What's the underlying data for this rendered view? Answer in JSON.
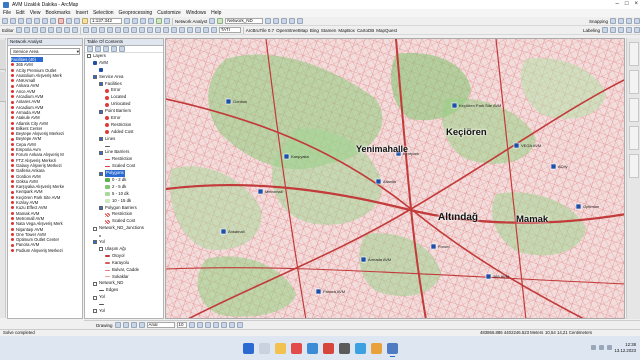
{
  "window": {
    "title": "AVM Uzaklık Dakika - ArcMap"
  },
  "menu": [
    "File",
    "Edit",
    "View",
    "Bookmarks",
    "Insert",
    "Selection",
    "Geoprocessing",
    "Customize",
    "Windows",
    "Help"
  ],
  "toolbar": {
    "scale": "1:137.342",
    "network_analyst_label": "Network Analyst",
    "network_dataset": "Network_ND",
    "georeferencing_layer": "TATI",
    "arcbrutile": "ArcBruTile 0.7",
    "osm": "OpenStreetMap",
    "bing": "Bing",
    "stamen": "Stamen",
    "mapbox": "MapBox",
    "cartodb": "CartoDB",
    "mapquest": "MapQuest",
    "snapping": "Snapping",
    "labeling": "Labeling",
    "editor": "Editor",
    "font": "Arial",
    "font_size": "10"
  },
  "network_analyst_panel": {
    "title": "Network Analyst",
    "selected_layer": "Service Area",
    "facilities_header": "Facilities (40)",
    "facilities": [
      "365 AVM",
      "ACity Premium Outlet",
      "Anatolium Alışveriş Merk",
      "ANKAmall",
      "Ankara AVM",
      "Ance AVM",
      "Arcadium AVM",
      "Antares AVM",
      "Arcadium AVM",
      "Armada AVM",
      "Atakule AVM",
      "Atlantis City AVM",
      "Bilkent Center",
      "Beytepe Alışveriş Merkezi",
      "Beytepe AVM",
      "Cepa AVM",
      "Emporia Avm",
      "Forum Ankara Alışveriş M",
      "FTZ Alışveriş Merkezi",
      "Galaxy Alışveriş Merkezi",
      "Galleria Ankara",
      "Gordion AVM",
      "Göksu AVM",
      "Karşıyaka Alışveriş Merke",
      "Kentpark AVM",
      "Keçiören Park Site AVM",
      "Kızılay AVM",
      "Kuzu Effect AVM",
      "Mamak AVM",
      "Metromall AVM",
      "Nata Vega Alışveriş Merk",
      "Nişantaşı AVM",
      "One Tower AVM",
      "Optimum Outlet Center",
      "Panora AVM",
      "Podium Alışveriş Merkezi"
    ],
    "status": "Solve completed"
  },
  "toc": {
    "title": "Table Of Contents",
    "items": [
      {
        "label": "Layers",
        "level": 0,
        "check": false,
        "sym": ""
      },
      {
        "label": "AVM",
        "level": 1,
        "check": true,
        "sym": "pin"
      },
      {
        "label": "",
        "level": 2,
        "check": false,
        "sym": "pin"
      },
      {
        "label": "Service Area",
        "level": 1,
        "check": true,
        "sym": ""
      },
      {
        "label": "Facilities",
        "level": 2,
        "check": true,
        "sym": ""
      },
      {
        "label": "Error",
        "level": 3,
        "check": false,
        "sym": "red"
      },
      {
        "label": "Located",
        "level": 3,
        "check": false,
        "sym": "red"
      },
      {
        "label": "Unlocated",
        "level": 3,
        "check": false,
        "sym": "red"
      },
      {
        "label": "Point Barriers",
        "level": 2,
        "check": true,
        "sym": ""
      },
      {
        "label": "Error",
        "level": 3,
        "check": false,
        "sym": "red"
      },
      {
        "label": "Restriction",
        "level": 3,
        "check": false,
        "sym": "red"
      },
      {
        "label": "Added Cost",
        "level": 3,
        "check": false,
        "sym": "red"
      },
      {
        "label": "Lines",
        "level": 2,
        "check": true,
        "sym": ""
      },
      {
        "label": "",
        "level": 3,
        "check": false,
        "sym": "line"
      },
      {
        "label": "Line Barriers",
        "level": 2,
        "check": true,
        "sym": ""
      },
      {
        "label": "Restriction",
        "level": 3,
        "check": false,
        "sym": "redline"
      },
      {
        "label": "Scaled Cost",
        "level": 3,
        "check": false,
        "sym": "redline"
      },
      {
        "label": "Polygons",
        "level": 2,
        "check": true,
        "sym": "",
        "highlight": true
      },
      {
        "label": "0 - 2 dk",
        "level": 3,
        "check": false,
        "sym": "green1"
      },
      {
        "label": "2 - 5 dk",
        "level": 3,
        "check": false,
        "sym": "green2"
      },
      {
        "label": "5 - 10 dk",
        "level": 3,
        "check": false,
        "sym": "green3"
      },
      {
        "label": "10 - 15 dk",
        "level": 3,
        "check": false,
        "sym": "green4"
      },
      {
        "label": "Polygon Barriers",
        "level": 2,
        "check": true,
        "sym": ""
      },
      {
        "label": "Restriction",
        "level": 3,
        "check": false,
        "sym": "hatch"
      },
      {
        "label": "Scaled Cost",
        "level": 3,
        "check": false,
        "sym": "hatch"
      },
      {
        "label": "Network_ND_Junctions",
        "level": 1,
        "check": false,
        "sym": ""
      },
      {
        "label": "",
        "level": 2,
        "check": false,
        "sym": "dot"
      },
      {
        "label": "Yol",
        "level": 1,
        "check": true,
        "sym": ""
      },
      {
        "label": "Ulaşım Ağı",
        "level": 2,
        "check": false,
        "sym": ""
      },
      {
        "label": "Otoyol",
        "level": 3,
        "check": false,
        "sym": "road1"
      },
      {
        "label": "Karayolu",
        "level": 3,
        "check": false,
        "sym": "road2"
      },
      {
        "label": "Bulvar, Cadde",
        "level": 3,
        "check": false,
        "sym": "road3"
      },
      {
        "label": "Sokaklar",
        "level": 3,
        "check": false,
        "sym": "road4"
      },
      {
        "label": "Network_ND",
        "level": 1,
        "check": false,
        "sym": ""
      },
      {
        "label": "Edges",
        "level": 2,
        "check": false,
        "sym": "line"
      },
      {
        "label": "Yol",
        "level": 1,
        "check": false,
        "sym": ""
      },
      {
        "label": "",
        "level": 2,
        "check": false,
        "sym": "line"
      },
      {
        "label": "Yol",
        "level": 1,
        "check": false,
        "sym": ""
      }
    ]
  },
  "map": {
    "labels": [
      {
        "text": "Keçiören",
        "cls": "big"
      },
      {
        "text": "Yenimahalle",
        "cls": "big"
      },
      {
        "text": "Altındağ",
        "cls": "big"
      },
      {
        "text": "Mamak",
        "cls": "big"
      }
    ],
    "pins": [
      "Keçiören Park Site AVM",
      "VEGA AVM",
      "Karşıyaka",
      "Gordion",
      "Atlantis",
      "Armada AVM",
      "Panora AVM",
      "ACity",
      "Optimum",
      "Metromall",
      "Ankamall",
      "Forum",
      "365 AVM",
      "Kentpark"
    ]
  },
  "drawing": {
    "label": "Drawing",
    "font": "Arial",
    "size": "10"
  },
  "status": {
    "left": "Solve completed",
    "coords": "483866.886 4402246.523 Meters",
    "page": "10,54 14,21 Centimeters"
  },
  "clock": {
    "time": "12:38",
    "date": "13.12.2023"
  },
  "colors": {
    "map_bg": "#f2d9d9",
    "zone_green": "#a7d79a",
    "road": "#d85c5c",
    "selection": "#2b6bd1"
  }
}
